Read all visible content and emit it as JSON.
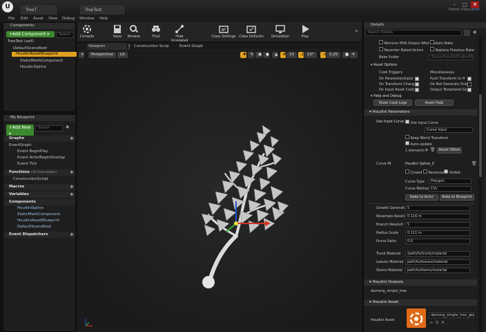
{
  "window": {
    "logo": "U",
    "tabs": [
      "TreeT",
      "TreeTest"
    ],
    "parent_class_label": "Parent class:",
    "parent_class_value": "Actor",
    "controls": [
      "–",
      "□",
      "✕"
    ]
  },
  "menu": [
    "File",
    "Edit",
    "Asset",
    "View",
    "Debug",
    "Window",
    "Help"
  ],
  "components": {
    "tab": "Components",
    "add_button": "+Add Component ▾",
    "search_placeholder": "Search",
    "self_item": "TreeTest (self)",
    "tree": [
      "DefaultSceneRoot",
      "HoudiniAssetBlueprint",
      "StaticMeshComponent",
      "HoudiniSpline"
    ]
  },
  "blueprint": {
    "tab": "My Blueprint",
    "add_new": "+Add New ▾",
    "search_placeholder": "Search",
    "graphs_label": "Graphs",
    "event_graph": "EventGraph",
    "events": [
      "Event BeginPlay",
      "Event ActorBeginOverlap",
      "Event Tick"
    ],
    "functions_label": "Functions",
    "functions_note": "(16 Overridable)",
    "construction": "ConstructionScript",
    "macros_label": "Macros",
    "variables_label": "Variables",
    "components_label": "Components",
    "components": [
      "HoudiniSpline",
      "StaticMeshComponent",
      "HoudiniAssetBlueprint",
      "DefaultSceneRoot"
    ],
    "dispatchers_label": "Event Dispatchers"
  },
  "toolbar": [
    {
      "label": "Compile",
      "icon": "compile-icon"
    },
    {
      "label": "Save",
      "icon": "save-icon"
    },
    {
      "label": "Browse",
      "icon": "browse-icon"
    },
    {
      "label": "Find",
      "icon": "find-icon"
    },
    {
      "label": "Hide Unrelated",
      "icon": "hide-unrelated-icon"
    },
    {
      "label": "Class Settings",
      "icon": "class-settings-icon"
    },
    {
      "label": "Class Defaults",
      "icon": "class-defaults-icon"
    },
    {
      "label": "Simulation",
      "icon": "simulation-icon"
    },
    {
      "label": "Play",
      "icon": "play-icon"
    }
  ],
  "viewport": {
    "tabs": [
      "Viewport",
      "Construction Scrip",
      "Event Graph"
    ],
    "perspective": "Perspective",
    "lit": "Lit",
    "grid": "10",
    "angle": "10°",
    "scale": "0.25",
    "cam": "4"
  },
  "details": {
    "tab": "Details",
    "search_placeholder": "Search Details",
    "bake": {
      "remove_hda": "Remove HDA Output After Ba",
      "auto_bake": "Auto Bake",
      "recenter": "Recenter Baked Actors",
      "replace_prev": "Replace Previous Bake",
      "bake_folder_label": "Bake Folder",
      "bake_folder_value": "/Game/HoudiniEngine/Bake"
    },
    "asset_options": "Asset Options",
    "cook_triggers": "Cook Triggers",
    "misc": "Miscellaneous",
    "on_param": "On Parameter/Input",
    "push_transform": "Push Transform to H",
    "on_transform": "On Transform Chang",
    "no_gen_out": "Do Not Generate Outp",
    "on_input_cook": "On Input Asset Cook",
    "out_templated": "Output Templated Ge",
    "help_debug": "Help and Debug",
    "show_cook_logs": "Show Cook Logs",
    "asset_help": "Asset Help",
    "houdini_params": "Houdini Parameters",
    "use_input_curve_label": "Use Input Curve",
    "use_input_curve_chk": "Use Input Curve",
    "curve_input": "Curve Input",
    "keep_world": "Keep World Transform",
    "auto_update": "Auto-update",
    "elements": "1 elements",
    "reset_offset": "Reset Offset",
    "curve_in_label": "Curve IN",
    "curve_name": "Houdini Spline_0",
    "closed": "Closed",
    "reversed": "Reversed",
    "visible": "Visible",
    "curve_type_label": "Curve Type",
    "curve_type_value": "Polygon",
    "curve_method_label": "Curve Method",
    "curve_method_value": "CVs",
    "bake_to_actor": "Bake to Actor",
    "bake_to_blueprint": "Bake to Blueprint",
    "params": [
      {
        "label": "Growth Generati",
        "value": "5"
      },
      {
        "label": "Resample Resoli",
        "value": "0.116 m"
      },
      {
        "label": "Branch Resoluti",
        "value": "5"
      },
      {
        "label": "Radius Scale",
        "value": "0.111 m"
      },
      {
        "label": "Prune Ratio",
        "value": "0.0"
      }
    ],
    "materials": [
      {
        "label": "Trunk Material",
        "value": "/path/to/trunk/material"
      },
      {
        "label": "Leaves Material",
        "value": "path/to/leaves/material"
      },
      {
        "label": "Stems Material",
        "value": "path/to/stems/material"
      }
    ],
    "houdini_outputs": "Houdini Outputs",
    "output_name": "damong_simple_tree",
    "houdini_asset": "Houdini Asset",
    "houdini_asset_label": "Houdini Asset",
    "asset_value": "damong_simple_tree_gen"
  },
  "colors": {
    "accent_green": "#3d8a2e",
    "selection": "#e0a020",
    "panel": "#1e1e1e"
  }
}
